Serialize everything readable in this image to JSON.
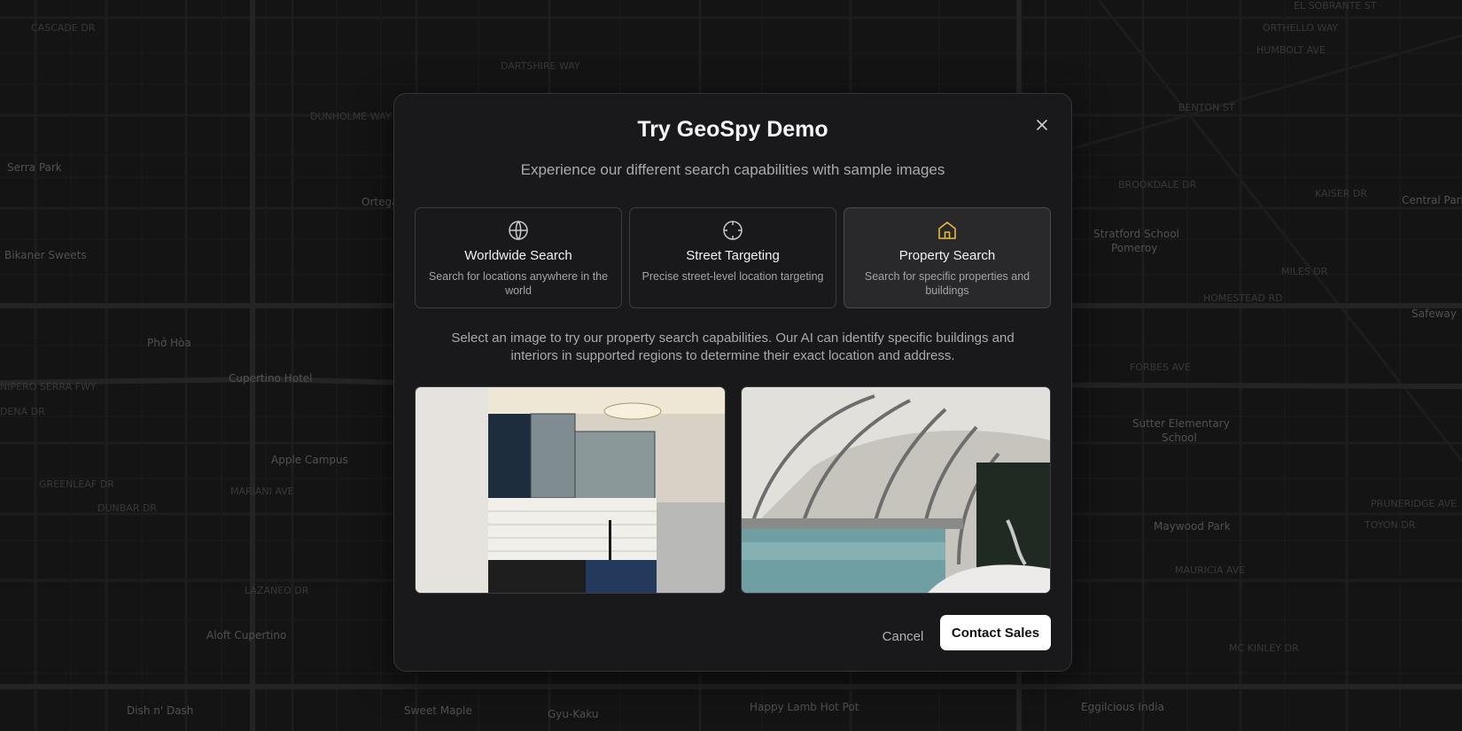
{
  "map": {
    "labels": [
      "CASCADE DR",
      "DARTSHIRE WAY",
      "DUNHOLME WAY",
      "Ortega",
      "Bikaner Sweets",
      "Serra Park",
      "Phở Hòa",
      "Cupertino Hotel",
      "NIPERO SERRA FWY",
      "DENA DR",
      "Apple Campus",
      "GREENLEAF DR",
      "DUNBAR DR",
      "MARIANI AVE",
      "LAZANEO DR",
      "Aloft Cupertino",
      "Dish n' Dash",
      "Sweet Maple",
      "Gyu-Kaku",
      "Happy Lamb Hot Pot",
      "Eggilcious India",
      "EL SOBRANTE ST",
      "ORTHELLO WAY",
      "HUMBOLT AVE",
      "BENTON ST",
      "KAISER DR",
      "Central Park",
      "BROOKDALE DR",
      "Stratford School Pomeroy",
      "MILES DR",
      "HOMESTEAD RD",
      "Safeway",
      "FORBES AVE",
      "Sutter Elementary School",
      "PRUNERIDGE AVE",
      "TOYON DR",
      "Maywood Park",
      "MAURICIA AVE",
      "MC KINLEY DR"
    ]
  },
  "modal": {
    "title": "Try GeoSpy Demo",
    "subtitle": "Experience our different search capabilities with sample images",
    "close_icon": "close-icon",
    "cards": [
      {
        "icon": "globe-icon",
        "title": "Worldwide Search",
        "desc": "Search for locations anywhere in the world"
      },
      {
        "icon": "crosshair-icon",
        "title": "Street Targeting",
        "desc": "Precise street-level location targeting"
      },
      {
        "icon": "house-icon",
        "title": "Property Search",
        "desc": "Search for specific properties and buildings",
        "selected": true
      }
    ],
    "description": "Select an image to try our property search capabilities. Our AI can identify specific buildings and interiors in supported regions to determine their exact location and address.",
    "cancel_label": "Cancel",
    "primary_label": "Contact Sales",
    "accent_color": "#e8b93a"
  }
}
